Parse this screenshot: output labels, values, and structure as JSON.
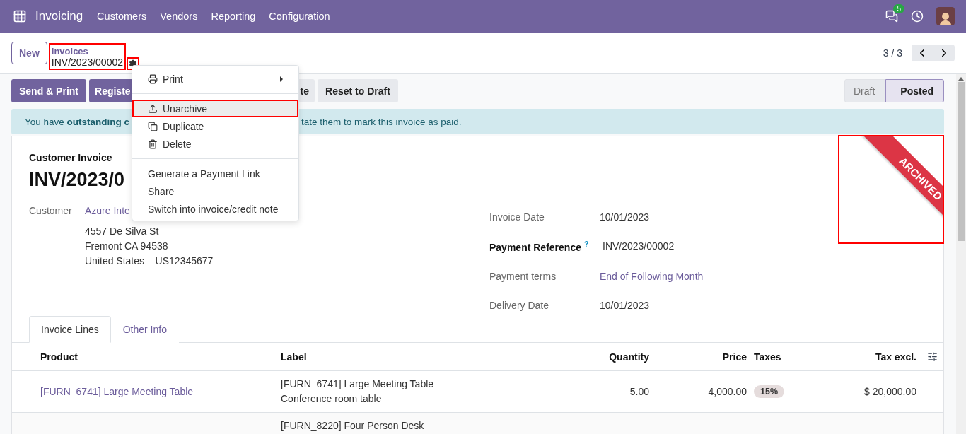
{
  "navbar": {
    "app": "Invoicing",
    "menu": [
      "Customers",
      "Vendors",
      "Reporting",
      "Configuration"
    ],
    "message_count": "5"
  },
  "control_panel": {
    "new_button": "New",
    "breadcrumb": "Invoices",
    "record": "INV/2023/00002",
    "outlined": true,
    "gear_outlined": true,
    "pager": "3 / 3"
  },
  "action_menu": {
    "groups": [
      {
        "kind": "icon",
        "items": [
          {
            "label": "Print",
            "submenu": true,
            "highlighted": false,
            "outlined": false
          }
        ]
      },
      {
        "kind": "icon",
        "items": [
          {
            "label": "Unarchive",
            "submenu": false,
            "highlighted": true,
            "outlined": true
          },
          {
            "label": "Duplicate",
            "submenu": false,
            "highlighted": false,
            "outlined": false
          },
          {
            "label": "Delete",
            "submenu": false,
            "highlighted": false,
            "outlined": false
          }
        ]
      },
      {
        "kind": "plain",
        "items": [
          {
            "label": "Generate a Payment Link",
            "submenu": false,
            "highlighted": false,
            "outlined": false
          },
          {
            "label": "Share",
            "submenu": false,
            "highlighted": false,
            "outlined": false
          },
          {
            "label": "Switch into invoice/credit note",
            "submenu": false,
            "highlighted": false,
            "outlined": false
          }
        ]
      }
    ]
  },
  "buttons": [
    {
      "label": "Send & Print",
      "primary": true
    },
    {
      "label": "Registe",
      "primary": true
    },
    {
      "label": "te",
      "primary": false
    },
    {
      "label": "Reset to Draft",
      "primary": false
    }
  ],
  "status": [
    {
      "label": "Draft",
      "selected": false
    },
    {
      "label": "Posted",
      "selected": true
    }
  ],
  "alert": [
    "You have **outstanding c**",
    "tate them to mark this invoice as paid."
  ],
  "sheet": {
    "type": "Customer Invoice",
    "name": "INV/2023/0",
    "customer_label": "Customer",
    "customer": "Azure Inte",
    "address": [
      "4557 De Silva St",
      "Fremont CA 94538",
      "United States – US12345677"
    ],
    "fields": [
      {
        "label": "Invoice Date",
        "value": "10/01/2023",
        "kind": "text",
        "emphasized": false
      },
      {
        "label": "Payment Reference",
        "help": "?",
        "value": "INV/2023/00002",
        "kind": "text",
        "emphasized": true
      },
      {
        "label": "Payment terms",
        "value": "End of Following Month",
        "kind": "link",
        "emphasized": false
      },
      {
        "label": "Delivery Date",
        "value": "10/01/2023",
        "kind": "text",
        "emphasized": false
      }
    ],
    "ribbon": {
      "label": "ARCHIVED",
      "outlined": true
    }
  },
  "tabs": [
    {
      "label": "Invoice Lines",
      "selected": true
    },
    {
      "label": "Other Info",
      "selected": false
    }
  ],
  "table": {
    "columns": [
      "Product",
      "Label",
      "Quantity",
      "Price",
      "Taxes",
      "Tax excl."
    ],
    "rows": [
      {
        "product": "[FURN_6741] Large Meeting Table",
        "label": [
          "[FURN_6741] Large Meeting Table",
          "Conference room table"
        ],
        "quantity": "5.00",
        "price": "4,000.00",
        "taxes": "15%",
        "total": "$ 20,000.00"
      },
      {
        "label": [
          "[FURN_8220] Four Person Desk"
        ]
      }
    ]
  }
}
